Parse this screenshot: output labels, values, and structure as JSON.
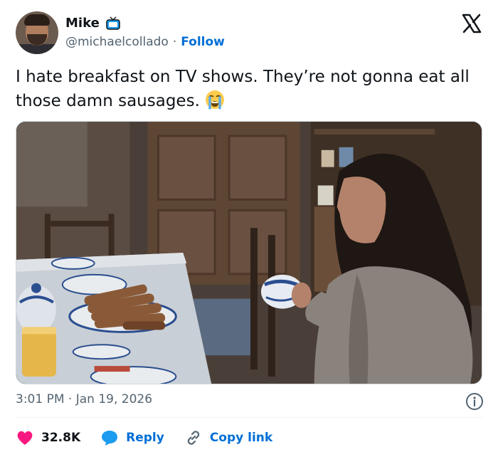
{
  "header": {
    "name": "Mike",
    "handle": "@michaelcollado",
    "separator": "·",
    "follow_label": "Follow",
    "badge_icon": "tv-icon",
    "platform_icon": "x-logo-icon"
  },
  "tweet": {
    "text": "I hate breakfast on TV shows. They’re not gonna eat all those damn sausages.",
    "emoji_icon": "crying-face-emoji"
  },
  "meta": {
    "timestamp": "3:01 PM · Jan 19, 2026"
  },
  "actions": {
    "like_count": "32.8K",
    "reply_label": "Reply",
    "copy_link_label": "Copy link"
  },
  "colors": {
    "accent": "#006fd6",
    "like": "#f91880",
    "muted": "#536471",
    "text": "#0f1419"
  }
}
